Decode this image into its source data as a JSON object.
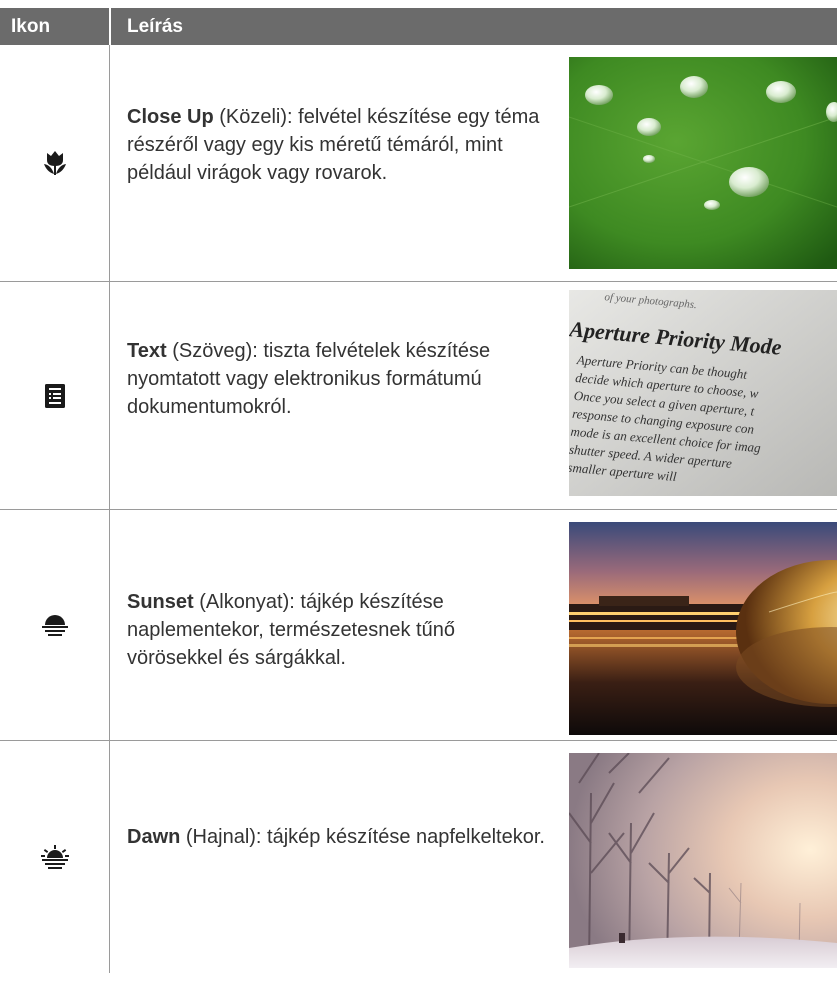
{
  "header": {
    "col_icon": "Ikon",
    "col_desc": "Leírás"
  },
  "rows": [
    {
      "icon": "macro-flower-icon",
      "title": "Close Up",
      "rest": " (Közeli): felvétel készítése egy téma részéről vagy egy kis méretű témáról, mint például virágok vagy rovarok."
    },
    {
      "icon": "text-document-icon",
      "title": "Text",
      "rest": " (Szöveg): tiszta felvételek készítése nyomtatott vagy elektronikus formátumú dokumentumokról.",
      "photo_text": {
        "top": "of your photographs.",
        "heading": "Aperture Priority Mode",
        "lines": [
          "Aperture Priority can be thought",
          "decide which aperture to choose, w",
          "Once you select a given aperture, t",
          "response to changing exposure con",
          "mode is an excellent choice for imag",
          "shutter speed. A wider aperture",
          "smaller aperture will"
        ]
      }
    },
    {
      "icon": "sunset-icon",
      "title": "Sunset",
      "rest": " (Alkonyat): tájkép készítése naplementekor, természetesnek tűnő vörösekkel és sárgákkal."
    },
    {
      "icon": "dawn-icon",
      "title": "Dawn",
      "rest": " (Hajnal): tájkép készítése napfelkeltekor."
    }
  ]
}
